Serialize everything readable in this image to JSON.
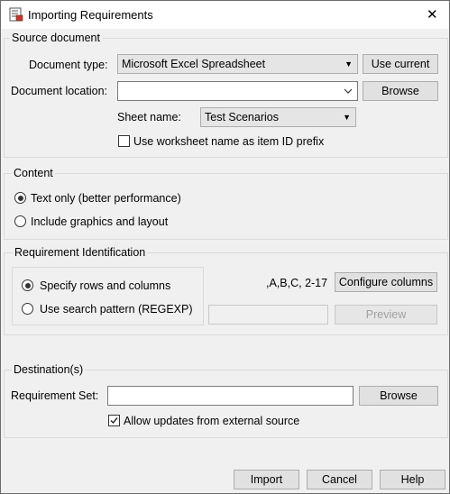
{
  "window": {
    "title": "Importing Requirements",
    "close_glyph": "✕",
    "icon": "requirements-app-icon"
  },
  "source": {
    "legend": "Source document",
    "doc_type_label": "Document type:",
    "doc_type_value": "Microsoft Excel Spreadsheet",
    "use_current_label": "Use current",
    "doc_location_label": "Document location:",
    "doc_location_value": "",
    "browse_label": "Browse",
    "sheet_label": "Sheet name:",
    "sheet_value": "Test Scenarios",
    "prefix_checkbox_label": "Use worksheet name as item ID prefix",
    "prefix_checked": false
  },
  "content": {
    "legend": "Content",
    "option_text_only": "Text only (better performance)",
    "option_graphics": "Include graphics and layout",
    "selected": "text_only"
  },
  "identification": {
    "legend": "Requirement Identification",
    "option_rows_cols": "Specify rows and columns",
    "option_search": "Use search pattern (REGEXP)",
    "selected": "rows_cols",
    "columns_summary": ",A,B,C, 2-17",
    "configure_label": "Configure columns",
    "search_pattern_value": "",
    "preview_label": "Preview"
  },
  "destination": {
    "legend": "Destination(s)",
    "req_set_label": "Requirement Set:",
    "req_set_value": "",
    "browse_label": "Browse",
    "allow_updates_label": "Allow updates from external source",
    "allow_updates_checked": true
  },
  "footer": {
    "import_label": "Import",
    "cancel_label": "Cancel",
    "help_label": "Help"
  }
}
